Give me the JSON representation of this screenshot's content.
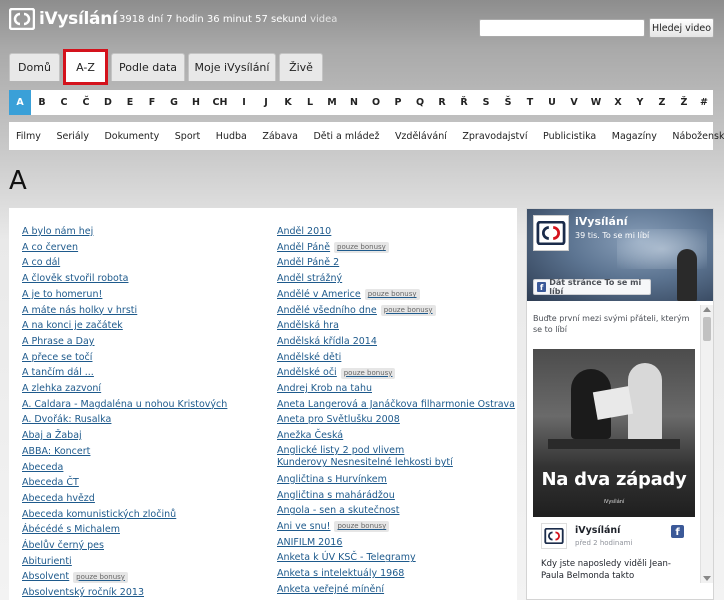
{
  "header": {
    "brand": "iVysílání",
    "counter_main": "3918 dní 7 hodin 36 minut 57 sekund",
    "counter_suffix": "videa",
    "search_placeholder": "",
    "search_button": "Hledej video"
  },
  "tabs": [
    {
      "label": "Domů",
      "active": false
    },
    {
      "label": "A-Z",
      "active": true
    },
    {
      "label": "Podle data",
      "active": false
    },
    {
      "label": "Moje iVysílání",
      "active": false
    },
    {
      "label": "Živě",
      "active": false
    }
  ],
  "letters": [
    "A",
    "B",
    "C",
    "Č",
    "D",
    "E",
    "F",
    "G",
    "H",
    "CH",
    "I",
    "J",
    "K",
    "L",
    "M",
    "N",
    "O",
    "P",
    "Q",
    "R",
    "Ř",
    "S",
    "Š",
    "T",
    "U",
    "V",
    "W",
    "X",
    "Y",
    "Z",
    "Ž",
    "#"
  ],
  "active_letter": "A",
  "categories": [
    "Filmy",
    "Seriály",
    "Dokumenty",
    "Sport",
    "Hudba",
    "Zábava",
    "Děti a mládež",
    "Vzdělávání",
    "Zpravodajství",
    "Publicistika",
    "Magazíny",
    "Náboženské"
  ],
  "section_heading": "A",
  "list_col1": [
    {
      "title": "A bylo nám hej"
    },
    {
      "title": "A co červen"
    },
    {
      "title": "A co dál"
    },
    {
      "title": "A člověk stvořil robota"
    },
    {
      "title": "A je to homerun!"
    },
    {
      "title": "A máte nás holky v hrsti"
    },
    {
      "title": "A na konci je začátek"
    },
    {
      "title": "A Phrase a Day"
    },
    {
      "title": "A přece se točí"
    },
    {
      "title": "A tančím dál ..."
    },
    {
      "title": "A zlehka zazvoní"
    },
    {
      "title": "A. Caldara - Magdaléna u nohou Kristových"
    },
    {
      "title": "A. Dvořák: Rusalka"
    },
    {
      "title": "Abaj a Žabaj"
    },
    {
      "title": "ABBA: Koncert"
    },
    {
      "title": "Abeceda"
    },
    {
      "title": "Abeceda ČT"
    },
    {
      "title": "Abeceda hvězd"
    },
    {
      "title": "Abeceda komunistických zločinů"
    },
    {
      "title": "Ábécédé s Michalem"
    },
    {
      "title": "Ábelův černý pes"
    },
    {
      "title": "Abiturienti"
    },
    {
      "title": "Absolvent",
      "badge": "pouze bonusy"
    },
    {
      "title": "Absolventský ročník 2013"
    }
  ],
  "list_col2": [
    {
      "title": "Anděl 2010"
    },
    {
      "title": "Anděl Páně",
      "badge": "pouze bonusy"
    },
    {
      "title": "Anděl Páně 2"
    },
    {
      "title": "Anděl strážný"
    },
    {
      "title": "Andělé v Americe",
      "badge": "pouze bonusy"
    },
    {
      "title": "Andělé všedního dne",
      "badge": "pouze bonusy"
    },
    {
      "title": "Andělská hra"
    },
    {
      "title": "Andělská křídla 2014"
    },
    {
      "title": "Andělské děti"
    },
    {
      "title": "Andělské oči",
      "badge": "pouze bonusy"
    },
    {
      "title": "Andrej Krob na tahu"
    },
    {
      "title": "Aneta Langerová a Janáčkova filharmonie Ostrava"
    },
    {
      "title": "Aneta pro Světlušku 2008"
    },
    {
      "title": "Anežka Česká"
    },
    {
      "title": "Anglické listy 2 pod vlivem Kunderovy Nesnesitelné lehkosti bytí",
      "wrap": true
    },
    {
      "title": "Angličtina s Hurvínkem"
    },
    {
      "title": "Angličtina s mahárádžou"
    },
    {
      "title": "Angola - sen a skutečnost"
    },
    {
      "title": "Ani ve snu!",
      "badge": "pouze bonusy"
    },
    {
      "title": "ANIFILM 2016"
    },
    {
      "title": "Anketa k ÚV KSČ - Telegramy"
    },
    {
      "title": "Anketa s intelektuály 1968"
    },
    {
      "title": "Anketa veřejné mínění"
    }
  ],
  "facebook": {
    "page_name": "iVysílání",
    "likes": "39 tis. To se mi líbí",
    "like_button": "Dát stránce To se mi líbí",
    "friends_text": "Buďte první mezi svými přáteli, kterým se to líbí",
    "post_image_title": "Na dva západy",
    "post_image_sub": "iVysílání",
    "post_author": "iVysílání",
    "post_time": "před 2 hodinami",
    "post_text": "Kdy jste naposledy viděli Jean-Paula Belmonda takto"
  },
  "colors": {
    "active_letter": "#3aa0d8",
    "active_tab_border": "#d4121c",
    "link": "#1e5a8c",
    "facebook": "#3b5998"
  }
}
